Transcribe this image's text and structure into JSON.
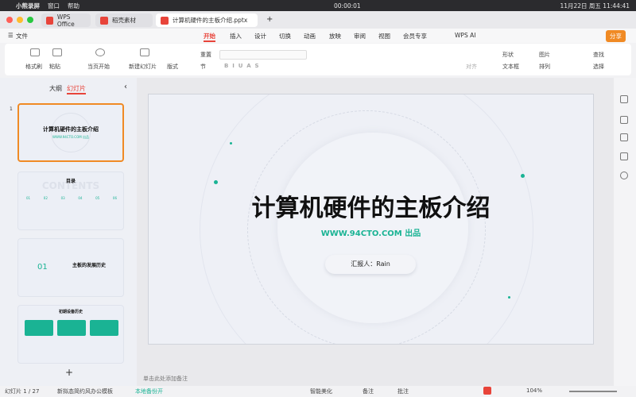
{
  "menubar": {
    "app": "小熊录屏",
    "items": [
      "窗口",
      "帮助"
    ],
    "recording_time": "00:00:01",
    "clock": "11月22日 周五 11:44:41"
  },
  "tabs": [
    {
      "label": "WPS Office"
    },
    {
      "label": "稻壳素材"
    },
    {
      "label": "计算机硬件的主板介绍.pptx"
    }
  ],
  "ribbon_tabs": {
    "file": "文件",
    "items": [
      "开始",
      "插入",
      "设计",
      "切换",
      "动画",
      "放映",
      "审阅",
      "视图",
      "会员专享"
    ],
    "ai": "WPS AI",
    "share": "分享"
  },
  "toolbar": {
    "format_painter": "格式刷",
    "paste": "粘贴",
    "from_current": "当页开始",
    "new_slide": "新建幻灯片",
    "layout": "版式",
    "section": "节",
    "reset": "重置",
    "shape": "形状",
    "picture": "图片",
    "textbox": "文本框",
    "arrange": "排列",
    "find": "查找",
    "select": "选择",
    "align": "对齐"
  },
  "panel": {
    "outline": "大纲",
    "slides": "幻灯片",
    "add": "+"
  },
  "thumbs": {
    "t1": {
      "num": "1",
      "title": "计算机硬件的主板介绍",
      "sub": "WWW.94CTO.COM 出品"
    },
    "t2": {
      "title": "目录",
      "bg": "CONTENTS",
      "nums": [
        "01",
        "02",
        "03",
        "04",
        "05",
        "06"
      ]
    },
    "t3": {
      "num": "01",
      "title": "主板的发展历史"
    },
    "t4": {
      "title": "初期设备历史"
    }
  },
  "slide": {
    "title": "计算机硬件的主板介绍",
    "subtitle": "WWW.94CTO.COM 出品",
    "presenter": "汇报人：Rain"
  },
  "notes": "单击此处添加备注",
  "status": {
    "slide_count": "幻灯片 1 / 27",
    "theme": "新拟态简约风办公模板",
    "backup": "本地备份开",
    "beautify": "智能美化",
    "notes": "备注",
    "comment": "批注",
    "zoom": "104%"
  },
  "colors": {
    "accent": "#1ab394",
    "orange": "#f08a24",
    "wps_red": "#e8443a"
  }
}
